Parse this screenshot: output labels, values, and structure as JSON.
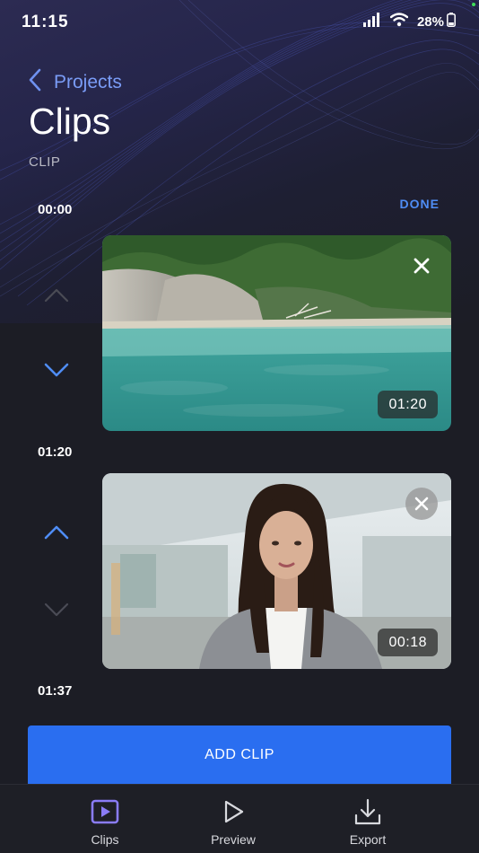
{
  "status_bar": {
    "time": "11:15",
    "battery": "28%"
  },
  "header": {
    "back_label": "Projects",
    "title": "Clips",
    "subtitle": "CLIP"
  },
  "timeline": {
    "done_label": "DONE",
    "marks": [
      "00:00",
      "01:20",
      "01:37"
    ]
  },
  "clips": [
    {
      "duration": "01:20",
      "scene": "lagoon beach with cliffs",
      "remove_icon": "close-icon",
      "move_up_enabled": false,
      "move_down_enabled": true
    },
    {
      "duration": "00:18",
      "scene": "woman speaking to camera",
      "remove_icon": "close-icon",
      "move_up_enabled": true,
      "move_down_enabled": false
    }
  ],
  "add_clip_label": "ADD CLIP",
  "tabs": [
    {
      "label": "Clips",
      "icon": "play-square-icon",
      "active": true
    },
    {
      "label": "Preview",
      "icon": "play-icon",
      "active": false
    },
    {
      "label": "Export",
      "icon": "download-icon",
      "active": false
    }
  ],
  "colors": {
    "accent": "#2a6ef0",
    "link": "#7a9cf6",
    "active_tab": "#8a7cf6",
    "background": "#1c1d25"
  }
}
